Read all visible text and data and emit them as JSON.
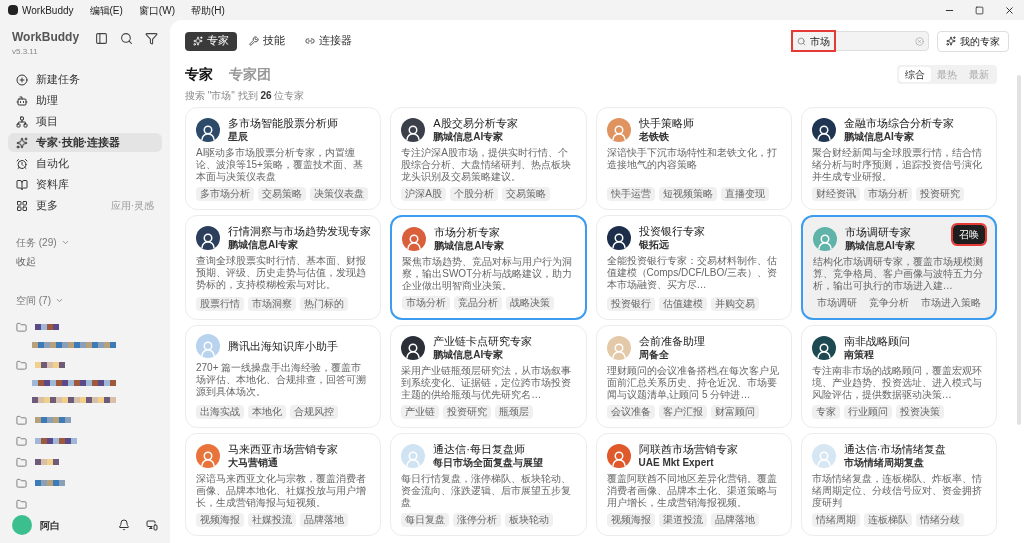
{
  "titlebar": {
    "app": "WorkBuddy",
    "menus": [
      "编辑(E)",
      "窗口(W)",
      "帮助(H)"
    ]
  },
  "sidebar": {
    "app_name": "WorkBuddy",
    "version": "v5.3.11",
    "nav": [
      {
        "label": "新建任务",
        "selected": false
      },
      {
        "label": "助理",
        "selected": false
      },
      {
        "label": "项目",
        "selected": false
      },
      {
        "label": "专家·技能·连接器",
        "selected": true
      },
      {
        "label": "自动化",
        "selected": false
      },
      {
        "label": "资料库",
        "selected": false
      },
      {
        "label": "更多",
        "selected": false,
        "hint": "应用·灵感"
      }
    ],
    "tasks": {
      "label": "任务 (29)",
      "action": "收起"
    },
    "spaces": {
      "label": "空间 (7)",
      "items": [
        {
          "redacted": true,
          "children": [
            {
              "redacted": true
            }
          ]
        },
        {
          "redacted": true,
          "children": [
            {
              "redacted": true
            },
            {
              "redacted": true
            }
          ]
        },
        {
          "redacted": true
        },
        {
          "redacted": true
        },
        {
          "redacted": true
        },
        {
          "redacted": true
        },
        {
          "redacted": false
        }
      ]
    },
    "user": {
      "name": "阿白"
    }
  },
  "top_tabs": [
    {
      "label": "专家",
      "selected": true
    },
    {
      "label": "技能",
      "selected": false
    },
    {
      "label": "连接器",
      "selected": false
    }
  ],
  "search": {
    "value": "市场",
    "marked": true
  },
  "my_experts_button": "我的专家",
  "section_tabs": [
    {
      "label": "专家",
      "selected": true
    },
    {
      "label": "专家团",
      "selected": false
    }
  ],
  "sort": [
    {
      "label": "综合",
      "selected": true
    },
    {
      "label": "最热",
      "selected": false
    },
    {
      "label": "最新",
      "selected": false
    }
  ],
  "result_text": "搜索 \"市场\" 找到 **26** 位专家",
  "cards": [
    {
      "title": "多市场智能股票分析师",
      "subtitle": "星辰",
      "color": "#2d4a6b",
      "desc": "AI驱动多市场股票分析专家，内置缠论、波浪等15+策略，覆盖技术面、基本面与决策仪表盘",
      "tags": [
        "多市场分析",
        "交易策略",
        "决策仪表盘"
      ],
      "selected": false,
      "hovered": false
    },
    {
      "title": "A股交易分析专家",
      "subtitle": "鹏城信息AI专家",
      "color": "#3a3f4a",
      "desc": "专注沪深A股市场，提供实时行情、个股综合分析、大盘情绪研判、热点板块龙头识别及交易策略建议。",
      "tags": [
        "沪深A股",
        "个股分析",
        "交易策略"
      ],
      "selected": false,
      "hovered": false
    },
    {
      "title": "快手策略师",
      "subtitle": "老铁铁",
      "color": "#e0925f",
      "desc": "深谙快手下沉市场特性和老铁文化，打造接地气的内容策略",
      "tags": [
        "快手运营",
        "短视频策略",
        "直播变现"
      ],
      "selected": false,
      "hovered": false
    },
    {
      "title": "金融市场综合分析专家",
      "subtitle": "鹏城信息AI专家",
      "color": "#1f3552",
      "desc": "聚合财经新闻与全球股票行情，结合情绪分析与时序预测，追踪投资信号演化并生成专业研报。",
      "tags": [
        "财经资讯",
        "市场分析",
        "投资研究"
      ],
      "selected": false,
      "hovered": false
    },
    {
      "title": "行情洞察与市场趋势发现专家",
      "subtitle": "鹏城信息AI专家",
      "color": "#2b3f5c",
      "desc": "查询全球股票实时行情、基本面、财报预期、评级、历史走势与估值，发现趋势标的，支持模糊检索与对比。",
      "tags": [
        "股票行情",
        "市场洞察",
        "热门标的"
      ],
      "selected": false,
      "hovered": false
    },
    {
      "title": "市场分析专家",
      "subtitle": "鹏城信息AI专家",
      "color": "#d9603b",
      "desc": "聚焦市场趋势、竞品对标与用户行为洞察，输出SWOT分析与战略建议，助力企业做出明智商业决策。",
      "tags": [
        "市场分析",
        "竞品分析",
        "战略决策"
      ],
      "selected": true,
      "hovered": false
    },
    {
      "title": "投资银行专家",
      "subtitle": "银拓远",
      "color": "#1c2e4a",
      "desc": "全能投资银行专家：交易材料制作、估值建模（Comps/DCF/LBO/三表）、资本市场融资、买方尽…",
      "tags": [
        "投资银行",
        "估值建模",
        "并购交易"
      ],
      "selected": false,
      "hovered": false
    },
    {
      "title": "市场调研专家",
      "subtitle": "鹏城信息AI专家",
      "color": "#5fb3a8",
      "desc": "结构化市场调研专家，覆盖市场规模测算、竞争格局、客户画像与波特五力分析，输出可执行的市场进入建…",
      "tags": [
        "市场调研",
        "竞争分析",
        "市场进入策略"
      ],
      "selected": true,
      "hovered": true,
      "action": {
        "label": "召唤",
        "marked": true
      }
    },
    {
      "title": "腾讯出海知识库小助手",
      "color": "#b9d3ee",
      "desc": "270+ 篇一线操盘手出海经验，覆盖市场评估、本地化、合规排查，回答可溯源到具体场次。",
      "tags": [
        "出海实战",
        "本地化",
        "合规风控"
      ],
      "selected": false,
      "hovered": false
    },
    {
      "title": "产业链卡点研究专家",
      "subtitle": "鹏城信息AI专家",
      "color": "#2a2f38",
      "desc": "采用产业链瓶颈层研究法，从市场叙事到系统变化、证据链，定位跨市场投资主题的供给瓶颈与优先研究名…",
      "tags": [
        "产业链",
        "投资研究",
        "瓶颈层"
      ],
      "selected": false,
      "hovered": false
    },
    {
      "title": "会前准备助理",
      "subtitle": "周备全",
      "color": "#e3c9a8",
      "desc": "理财顾问的会议准备搭档,在每次客户见面前汇总关系历史、持仓近况、市场要闻与议题清单,让顾问 5 分钟进…",
      "tags": [
        "会议准备",
        "客户汇报",
        "财富顾问"
      ],
      "selected": false,
      "hovered": false
    },
    {
      "title": "南非战略顾问",
      "subtitle": "南策程",
      "color": "#1d4a52",
      "desc": "专注南非市场的战略顾问，覆盖宏观环境、产业趋势、投资选址、进入模式与风险评估，提供数据驱动决策…",
      "tags": [
        "专家",
        "行业顾问",
        "投资决策"
      ],
      "selected": false,
      "hovered": false
    },
    {
      "title": "马来西亚市场营销专家",
      "subtitle": "大马营销通",
      "color": "#e8743b",
      "desc": "深谙马来西亚文化与宗教，覆盖消费者画像、品牌本地化、社媒投放与用户增长，生成营销海报与短视频。",
      "tags": [
        "视频海报",
        "社媒投流",
        "品牌落地"
      ],
      "selected": false,
      "hovered": false
    },
    {
      "title": "通达信·每日复盘师",
      "subtitle": "每日市场全面复盘与展望",
      "color": "#cfe3f3",
      "desc": "每日行情复盘，涨停梯队、板块轮动、资金流向、涨跌逻辑、后市展望五步复盘",
      "tags": [
        "每日复盘",
        "涨停分析",
        "板块轮动"
      ],
      "selected": false,
      "hovered": false
    },
    {
      "title": "阿联酋市场营销专家",
      "subtitle": "UAE Mkt Expert",
      "color": "#e0592a",
      "desc": "覆盖阿联酋不同地区差异化营销。覆盖消费者画像、品牌本土化、渠道策略与用户增长，生成营销海报视频。",
      "tags": [
        "视频海报",
        "渠道投流",
        "品牌落地"
      ],
      "selected": false,
      "hovered": false
    },
    {
      "title": "通达信·市场情绪复盘",
      "subtitle": "市场情绪周期复盘",
      "color": "#d6e6f2",
      "desc": "市场情绪复盘，连板梯队、炸板率、情绪周期定位、分歧信号应对、资金拥挤度研判",
      "tags": [
        "情绪周期",
        "连板梯队",
        "情绪分歧"
      ],
      "selected": false,
      "hovered": false
    }
  ]
}
